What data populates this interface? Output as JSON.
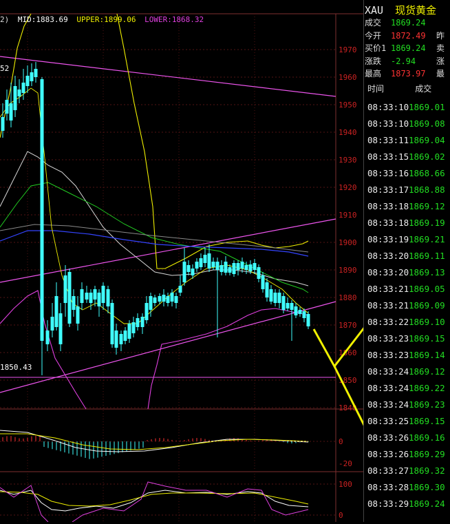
{
  "chart": {
    "legend_prefix": "2)",
    "mid": "MID:1883.69",
    "upper": "UPPER:1899.06",
    "lower": "LOWER:1868.32",
    "price_ticks": [
      "1970",
      "1960",
      "1950",
      "1940",
      "1930",
      "1920",
      "1910",
      "1900",
      "1890",
      "1880",
      "1870",
      "1860",
      "1850",
      "1840"
    ],
    "macd_ticks": [
      "0",
      "-20"
    ],
    "kdj_ticks": [
      "100",
      "0"
    ],
    "low_label": "1850.43",
    "high_label_frag": "52",
    "colors": {
      "upper": "#f0f000",
      "lower": "#e040e0",
      "mid": "#ffffff",
      "up": "#ff3030",
      "down": "#40ffff"
    }
  },
  "header": {
    "symbol": "XAU",
    "name": "现货黄金"
  },
  "quote": [
    {
      "label": "成交",
      "value": "1869.24",
      "color": "#22dd22",
      "extra": ""
    },
    {
      "label": "今开",
      "value": "1872.49",
      "color": "#ff3333",
      "extra": "昨"
    },
    {
      "label": "买价1",
      "value": "1869.24",
      "color": "#22dd22",
      "extra": "卖"
    },
    {
      "label": "涨跌",
      "value": "-2.94",
      "color": "#22dd22",
      "extra": "涨"
    },
    {
      "label": "最高",
      "value": "1873.97",
      "color": "#ff3333",
      "extra": "最"
    }
  ],
  "ticks_header": {
    "time": "时间",
    "deal": "成交"
  },
  "ticks": [
    {
      "time": "08:33:10",
      "price": "1869.01"
    },
    {
      "time": "08:33:10",
      "price": "1869.08"
    },
    {
      "time": "08:33:11",
      "price": "1869.04"
    },
    {
      "time": "08:33:15",
      "price": "1869.02"
    },
    {
      "time": "08:33:16",
      "price": "1868.66"
    },
    {
      "time": "08:33:17",
      "price": "1868.88"
    },
    {
      "time": "08:33:18",
      "price": "1869.12"
    },
    {
      "time": "08:33:18",
      "price": "1869.19"
    },
    {
      "time": "08:33:19",
      "price": "1869.21"
    },
    {
      "time": "08:33:20",
      "price": "1869.11"
    },
    {
      "time": "08:33:20",
      "price": "1869.13"
    },
    {
      "time": "08:33:21",
      "price": "1869.05"
    },
    {
      "time": "08:33:21",
      "price": "1869.09"
    },
    {
      "time": "08:33:22",
      "price": "1869.10"
    },
    {
      "time": "08:33:23",
      "price": "1869.15"
    },
    {
      "time": "08:33:23",
      "price": "1869.14"
    },
    {
      "time": "08:33:24",
      "price": "1869.12"
    },
    {
      "time": "08:33:24",
      "price": "1869.22"
    },
    {
      "time": "08:33:24",
      "price": "1869.23"
    },
    {
      "time": "08:33:25",
      "price": "1869.15"
    },
    {
      "time": "08:33:26",
      "price": "1869.16"
    },
    {
      "time": "08:33:26",
      "price": "1869.29"
    },
    {
      "time": "08:33:27",
      "price": "1869.32"
    },
    {
      "time": "08:33:28",
      "price": "1869.30"
    },
    {
      "time": "08:33:29",
      "price": "1869.24"
    }
  ]
}
